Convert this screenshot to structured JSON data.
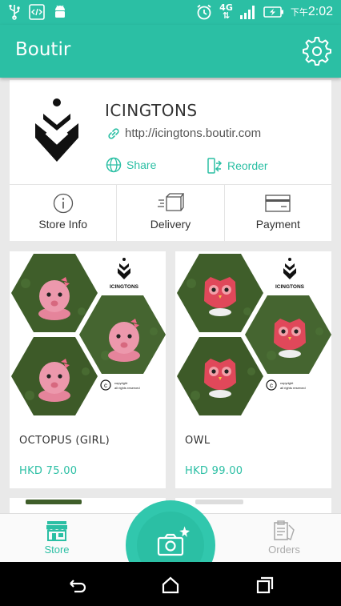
{
  "status_bar": {
    "ampm": "下午",
    "time": "2:02",
    "network": "4G",
    "icons": [
      "usb-icon",
      "code-icon",
      "android-icon",
      "alarm-icon",
      "network-4g-icon",
      "signal-icon",
      "battery-charging-icon"
    ]
  },
  "app_bar": {
    "title": "Boutir",
    "settings_icon": "gear-icon"
  },
  "store": {
    "name": "ICINGTONS",
    "url": "http://icingtons.boutir.com",
    "share_label": "Share",
    "reorder_label": "Reorder",
    "tabs": [
      {
        "label": "Store Info",
        "icon": "info-icon"
      },
      {
        "label": "Delivery",
        "icon": "delivery-icon"
      },
      {
        "label": "Payment",
        "icon": "card-icon"
      }
    ]
  },
  "products": [
    {
      "name": "OCTOPUS (GIRL)",
      "price": "HKD 75.00",
      "brand_mark": "ICINGTONS",
      "copyright": "© copyright all rights reserved"
    },
    {
      "name": "OWL",
      "price": "HKD 99.00",
      "brand_mark": "ICINGTONS",
      "copyright": "© copyright all rights reserved"
    }
  ],
  "bottom_nav": {
    "store_label": "Store",
    "orders_label": "Orders",
    "camera_icon": "camera-add-icon"
  },
  "colors": {
    "accent": "#2bbfa4",
    "octopus_pink": "#e98fa5",
    "owl_red": "#e0485a",
    "grass": "#3f5e2a"
  }
}
